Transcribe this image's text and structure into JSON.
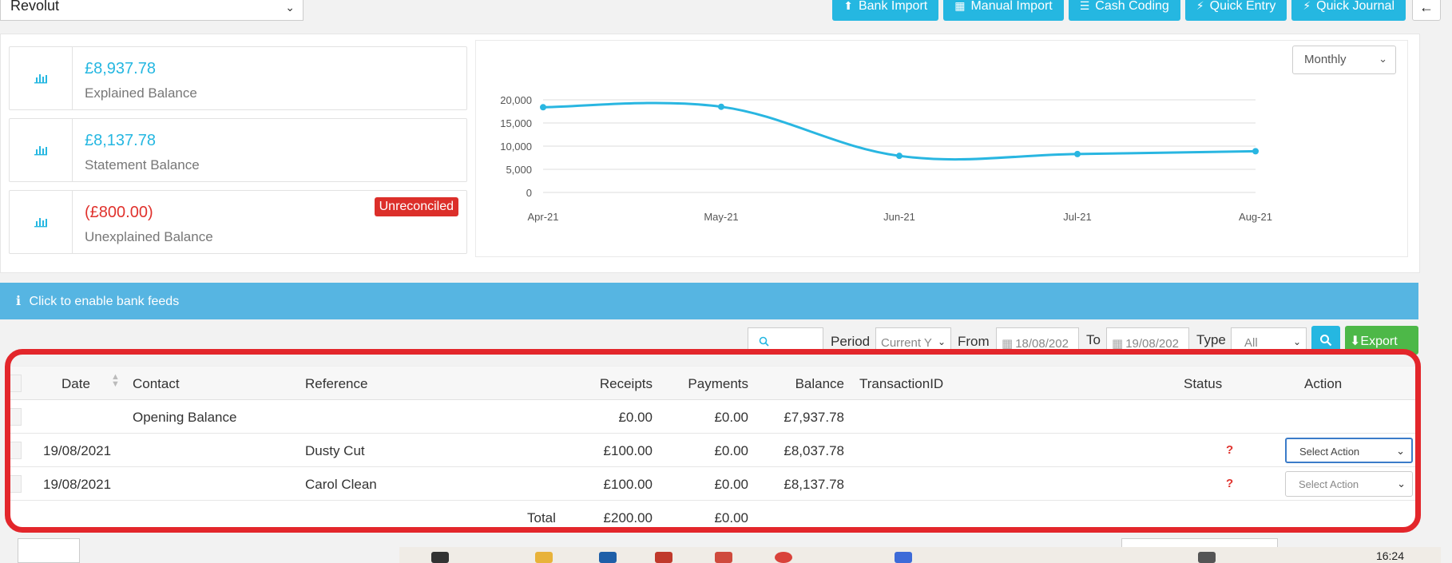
{
  "header": {
    "account": "Revolut",
    "buttons": [
      {
        "label": "Bank Import",
        "icon": "upload-icon"
      },
      {
        "label": "Manual Import",
        "icon": "table-icon"
      },
      {
        "label": "Cash Coding",
        "icon": "list-icon"
      },
      {
        "label": "Quick Entry",
        "icon": "bolt-icon"
      },
      {
        "label": "Quick Journal",
        "icon": "bolt-icon"
      }
    ],
    "back_icon": "arrow-left-icon"
  },
  "balances": [
    {
      "amount": "£8,937.78",
      "label": "Explained Balance",
      "icon": "bar-chart-icon"
    },
    {
      "amount": "£8,137.78",
      "label": "Statement Balance",
      "icon": "bar-chart-icon"
    },
    {
      "amount": "(£800.00)",
      "label": "Unexplained Balance",
      "icon": "bar-chart-icon",
      "badge": "Unreconciled"
    }
  ],
  "period_select": "Monthly",
  "chart_data": {
    "type": "line",
    "x": [
      "Apr-21",
      "May-21",
      "Jun-21",
      "Jul-21",
      "Aug-21"
    ],
    "series": [
      {
        "values": [
          18400,
          18500,
          7900,
          8300,
          8900
        ]
      }
    ],
    "ylim": [
      0,
      20000
    ],
    "yticks": [
      "20,000",
      "15,000",
      "10,000",
      "5,000",
      "0"
    ],
    "grid": true,
    "color": "#29b6e1"
  },
  "feeds_bar": {
    "icon": "info-icon",
    "text": "Click to enable bank feeds"
  },
  "filters": {
    "period_label": "Period",
    "period_value": "Current Y",
    "from_label": "From",
    "from_value": "18/08/202",
    "to_label": "To",
    "to_value": "19/08/202",
    "type_label": "Type",
    "type_value": "All",
    "export_label": "Export"
  },
  "table": {
    "columns": [
      "Date",
      "Contact",
      "Reference",
      "Receipts",
      "Payments",
      "Balance",
      "TransactionID",
      "Status",
      "Action"
    ],
    "opening": {
      "contact": "Opening Balance",
      "receipts": "£0.00",
      "payments": "£0.00",
      "balance": "£7,937.78"
    },
    "rows": [
      {
        "date": "19/08/2021",
        "reference": "Dusty Cut",
        "receipts": "£100.00",
        "payments": "£0.00",
        "balance": "£8,037.78",
        "status": "?",
        "action": "Select Action"
      },
      {
        "date": "19/08/2021",
        "reference": "Carol Clean",
        "receipts": "£100.00",
        "payments": "£0.00",
        "balance": "£8,137.78",
        "status": "?",
        "action": "Select Action"
      }
    ],
    "total": {
      "label": "Total",
      "receipts": "£200.00",
      "payments": "£0.00"
    }
  },
  "clock": "16:24"
}
